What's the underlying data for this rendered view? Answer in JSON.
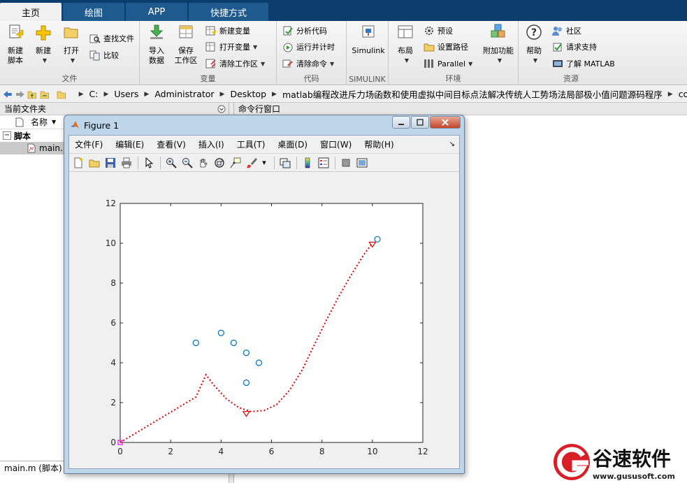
{
  "tabs": [
    "主页",
    "绘图",
    "APP",
    "快捷方式"
  ],
  "ribbon": {
    "file": {
      "label": "文件",
      "new_script": "新建\n脚本",
      "new": "新建",
      "open": "打开",
      "find_files": "查找文件",
      "compare": "比较"
    },
    "variable": {
      "label": "变量",
      "import": "导入\n数据",
      "save_ws": "保存\n工作区",
      "new_var": "新建变量",
      "open_var": "打开变量",
      "clear_ws": "清除工作区"
    },
    "code": {
      "label": "代码",
      "analyze": "分析代码",
      "run_time": "运行并计时",
      "clear_cmd": "清除命令"
    },
    "simulink": {
      "label": "SIMULINK",
      "simulink": "Simulink"
    },
    "env": {
      "label": "环境",
      "layout": "布局",
      "prefs": "预设",
      "set_path": "设置路径",
      "parallel": "Parallel",
      "addons": "附加功能"
    },
    "resources": {
      "label": "资源",
      "help": "帮助",
      "community": "社区",
      "support": "请求支持",
      "learn": "了解 MATLAB"
    }
  },
  "address": {
    "crumbs": [
      "C:",
      "Users",
      "Administrator",
      "Desktop",
      "matlab编程改进斥力场函数和使用虚拟中间目标点法解决传统人工势场法局部极小值问题源码程序",
      "code"
    ]
  },
  "left_panel": {
    "title": "当前文件夹",
    "col_name": "名称",
    "group": "脚本",
    "file": "main.",
    "footer": "main.m  (脚本)"
  },
  "cmd_panel": {
    "title": "命令行窗口"
  },
  "figure": {
    "title": "Figure 1",
    "menus": [
      "文件(F)",
      "编辑(E)",
      "查看(V)",
      "插入(I)",
      "工具(T)",
      "桌面(D)",
      "窗口(W)",
      "帮助(H)"
    ]
  },
  "chart_data": {
    "type": "line",
    "xlim": [
      0,
      12
    ],
    "ylim": [
      0,
      12
    ],
    "xticks": [
      0,
      2,
      4,
      6,
      8,
      10,
      12
    ],
    "yticks": [
      0,
      2,
      4,
      6,
      8,
      10,
      12
    ],
    "grid": false,
    "obstacles": [
      [
        3,
        5
      ],
      [
        4,
        5.5
      ],
      [
        4.5,
        5
      ],
      [
        5,
        4.5
      ],
      [
        5.5,
        4
      ],
      [
        5,
        3
      ],
      [
        10.2,
        10.2
      ]
    ],
    "path": [
      [
        0,
        0
      ],
      [
        0.5,
        0.38
      ],
      [
        1,
        0.76
      ],
      [
        1.5,
        1.14
      ],
      [
        2,
        1.52
      ],
      [
        2.5,
        1.9
      ],
      [
        3,
        2.28
      ],
      [
        3.4,
        3.4
      ],
      [
        3.7,
        2.9
      ],
      [
        4.2,
        2.2
      ],
      [
        4.7,
        1.75
      ],
      [
        5.2,
        1.55
      ],
      [
        5.7,
        1.6
      ],
      [
        6.2,
        1.9
      ],
      [
        6.7,
        2.6
      ],
      [
        7.2,
        3.6
      ],
      [
        7.7,
        4.9
      ],
      [
        8.2,
        6.2
      ],
      [
        8.7,
        7.4
      ],
      [
        9.2,
        8.5
      ],
      [
        9.7,
        9.5
      ],
      [
        10,
        10
      ]
    ],
    "path_color": "#e00000",
    "obstacle_color": "#0072bd",
    "start": [
      0,
      0
    ],
    "start_color": "#ff00ff",
    "virtual_goal": [
      5,
      1.45
    ],
    "goal": [
      10,
      9.95
    ],
    "marker_color": "#e00000"
  },
  "watermark": {
    "text": "谷速软件",
    "url": "www.gususoft.com"
  }
}
